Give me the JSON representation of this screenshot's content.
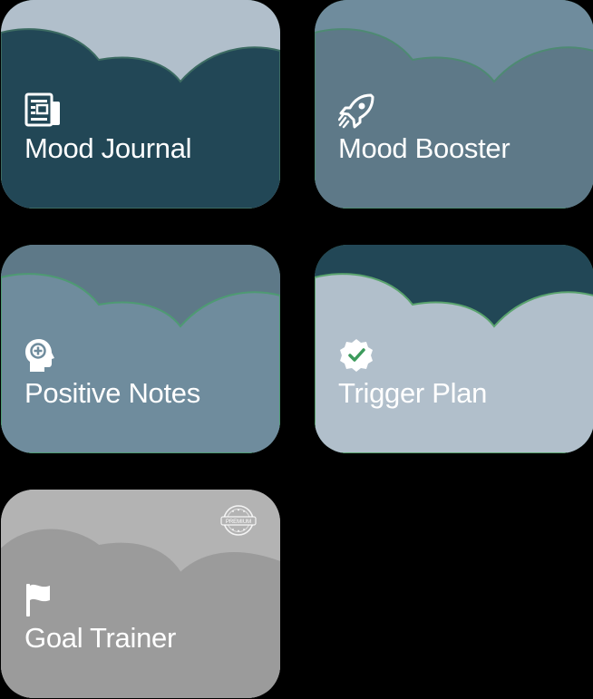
{
  "tiles": [
    {
      "label": "Mood Journal",
      "icon": "newspaper-icon",
      "colors": {
        "top": "#b1bfcb",
        "front": "#224756",
        "stroke": "#3c6b62"
      }
    },
    {
      "label": "Mood Booster",
      "icon": "rocket-icon",
      "colors": {
        "top": "#6f8c9d",
        "front": "#5e7988",
        "stroke": "#4e8a73"
      }
    },
    {
      "label": "Positive Notes",
      "icon": "head-plus-icon",
      "colors": {
        "top": "#5e7988",
        "front": "#6f8c9d",
        "stroke": "#4e9a73"
      }
    },
    {
      "label": "Trigger Plan",
      "icon": "check-badge-icon",
      "colors": {
        "top": "#224756",
        "front": "#b1bfcb",
        "stroke": "#5aa36e"
      }
    },
    {
      "label": "Goal Trainer",
      "icon": "flag-icon",
      "badge": "PREMIUM",
      "colors": {
        "top": "#b3b3b3",
        "front": "#9b9b9b",
        "stroke": "#9b9b9b"
      }
    }
  ]
}
